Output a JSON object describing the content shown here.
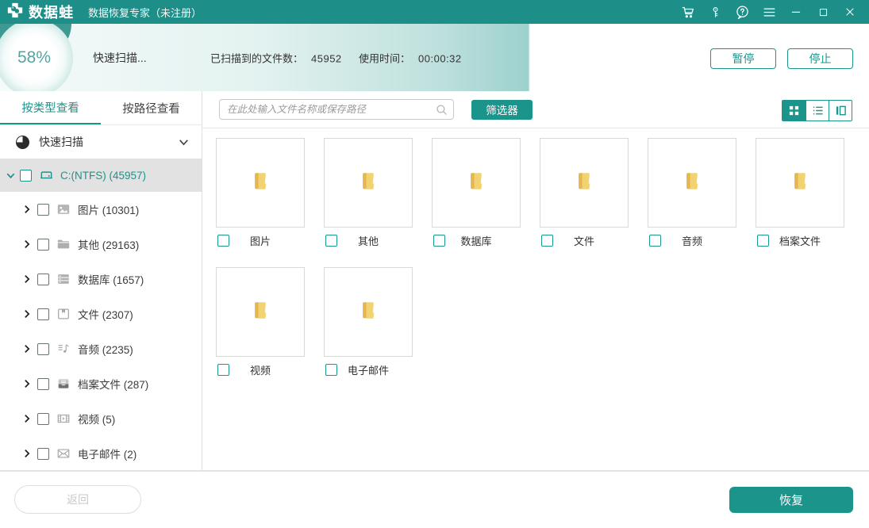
{
  "colors": {
    "accent": "#1b948c",
    "titlebar": "#1e8e88",
    "folder_front": "#f2d374",
    "folder_back": "#e6b74e"
  },
  "titlebar": {
    "app_name": "数据蛙",
    "subtitle": "数据恢复专家（未注册）",
    "icons": [
      "cart",
      "key",
      "help",
      "menu",
      "minimize",
      "maximize",
      "close"
    ]
  },
  "progress": {
    "percent": "58%",
    "status": "快速扫描...",
    "scanned_label": "已扫描到的文件数：",
    "scanned_value": "45952",
    "time_label": "使用时间：",
    "time_value": "00:00:32",
    "pause_label": "暂停",
    "stop_label": "停止"
  },
  "sidebar": {
    "tabs": [
      {
        "label": "按类型查看",
        "active": true
      },
      {
        "label": "按路径查看",
        "active": false
      }
    ],
    "scan_mode": "快速扫描",
    "root": {
      "label": "C:(NTFS) (45957)",
      "icon": "drive-icon",
      "expanded": true
    },
    "items": [
      {
        "label": "图片",
        "count": "10301",
        "icon": "image"
      },
      {
        "label": "其他",
        "count": "29163",
        "icon": "folder"
      },
      {
        "label": "数据库",
        "count": "1657",
        "icon": "database"
      },
      {
        "label": "文件",
        "count": "2307",
        "icon": "document"
      },
      {
        "label": "音频",
        "count": "2235",
        "icon": "music"
      },
      {
        "label": "档案文件",
        "count": "287",
        "icon": "archive"
      },
      {
        "label": "视频",
        "count": "5",
        "icon": "video"
      },
      {
        "label": "电子邮件",
        "count": "2",
        "icon": "mail"
      }
    ]
  },
  "main": {
    "search_placeholder": "在此处输入文件名称或保存路径",
    "filter_label": "筛选器",
    "view_modes": [
      {
        "name": "grid-view",
        "active": true
      },
      {
        "name": "list-view",
        "active": false
      },
      {
        "name": "column-view",
        "active": false
      }
    ],
    "folders": [
      "图片",
      "其他",
      "数据库",
      "文件",
      "音频",
      "档案文件",
      "视频",
      "电子邮件"
    ]
  },
  "footer": {
    "back_label": "返回",
    "recover_label": "恢复"
  }
}
